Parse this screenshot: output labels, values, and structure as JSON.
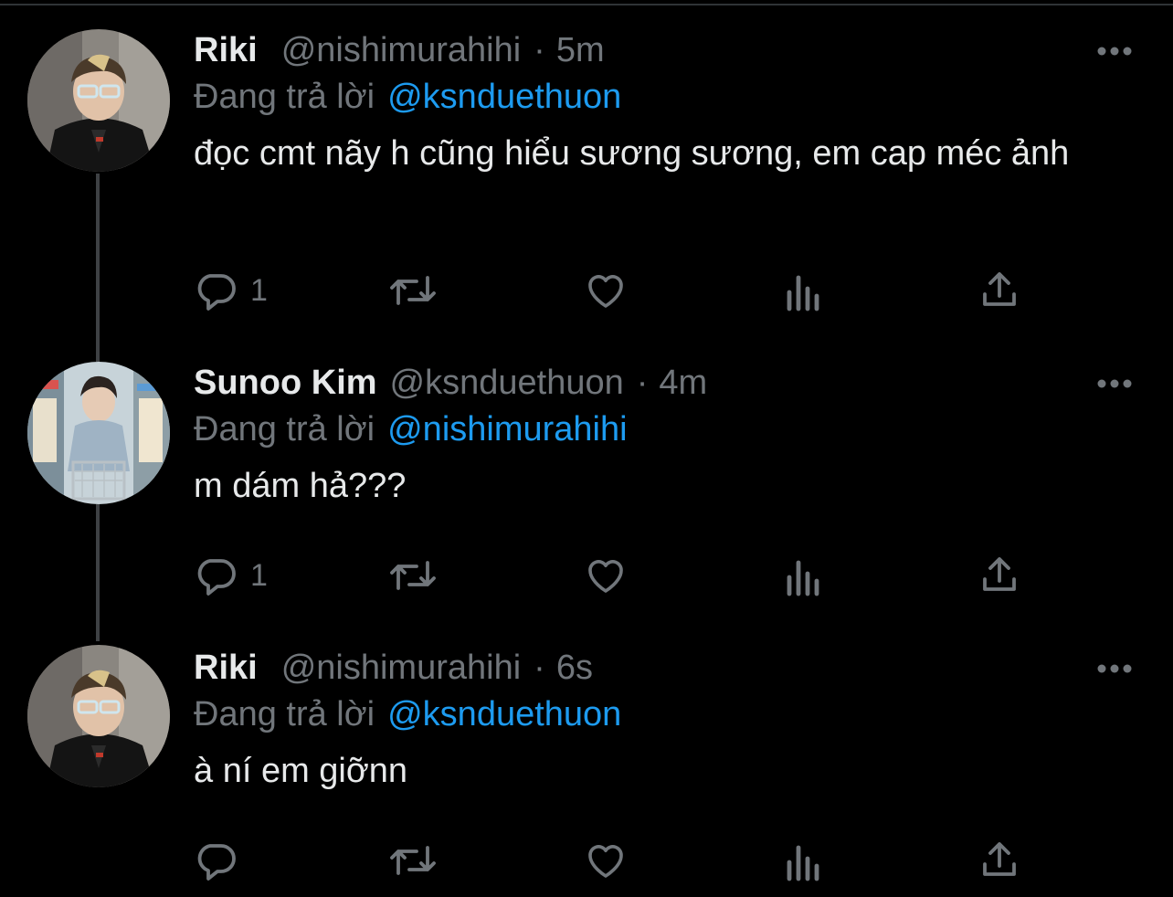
{
  "colors": {
    "background": "#000000",
    "primary_text": "#e7e9ea",
    "secondary_text": "#71767b",
    "mention": "#1d9bf0",
    "thread_line": "#3e4144"
  },
  "tweets": [
    {
      "name": "Riki",
      "handle": "@nishimurahihi",
      "separator": "·",
      "time": "5m",
      "replying_label": "Đang trả lời",
      "replying_to": "@ksnduethuon",
      "text": "đọc cmt nãy h cũng hiểu sương sương, em cap méc ảnh",
      "reply_count": "1",
      "avatar": "riki-avatar"
    },
    {
      "name": "Sunoo Kim",
      "handle": "@ksnduethuon",
      "separator": "·",
      "time": "4m",
      "replying_label": "Đang trả lời",
      "replying_to": "@nishimurahihi",
      "text": "m dám hả???",
      "reply_count": "1",
      "avatar": "sunoo-avatar"
    },
    {
      "name": "Riki",
      "handle": "@nishimurahihi",
      "separator": "·",
      "time": "6s",
      "replying_label": "Đang trả lời",
      "replying_to": "@ksnduethuon",
      "text": "à ní em giỡnn",
      "reply_count": "",
      "avatar": "riki-avatar"
    }
  ],
  "icons": [
    "more-icon",
    "reply-icon",
    "retweet-icon",
    "like-icon",
    "views-icon",
    "share-icon"
  ]
}
